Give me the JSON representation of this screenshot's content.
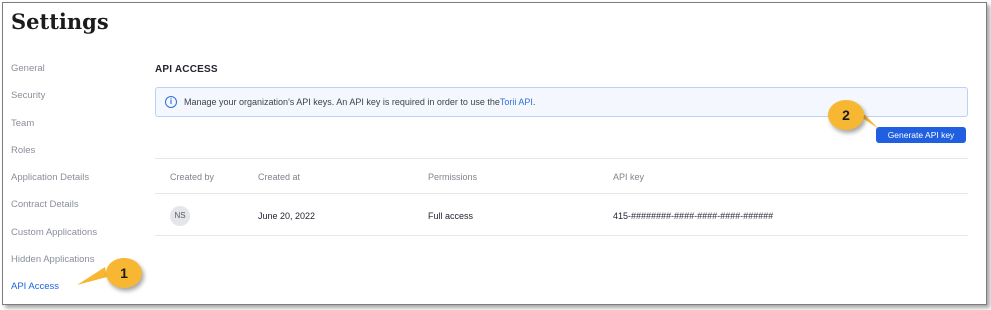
{
  "page": {
    "title": "Settings"
  },
  "sidebar": {
    "items": [
      {
        "label": "General"
      },
      {
        "label": "Security"
      },
      {
        "label": "Team"
      },
      {
        "label": "Roles"
      },
      {
        "label": "Application Details"
      },
      {
        "label": "Contract Details"
      },
      {
        "label": "Custom Applications"
      },
      {
        "label": "Hidden Applications"
      },
      {
        "label": "API Access"
      }
    ],
    "active": "API Access"
  },
  "main": {
    "section_title": "API ACCESS",
    "info": {
      "text": "Manage your organization's API keys. An API key is required in order to use the ",
      "link": "Torii API",
      "suffix": "."
    },
    "generate_button": "Generate API key",
    "table": {
      "columns": [
        "Created by",
        "Created at",
        "Permissions",
        "API key"
      ],
      "rows": [
        {
          "created_by": "NS",
          "created_at": "June 20, 2022",
          "permissions": "Full access",
          "api_key": "415-########-####-####-####-######"
        }
      ]
    }
  },
  "annotations": {
    "callouts": [
      {
        "label": "1"
      },
      {
        "label": "2"
      }
    ],
    "color": "#f7b733"
  },
  "colors": {
    "accent": "#1f5fe0",
    "active_nav": "#1d63e0"
  }
}
